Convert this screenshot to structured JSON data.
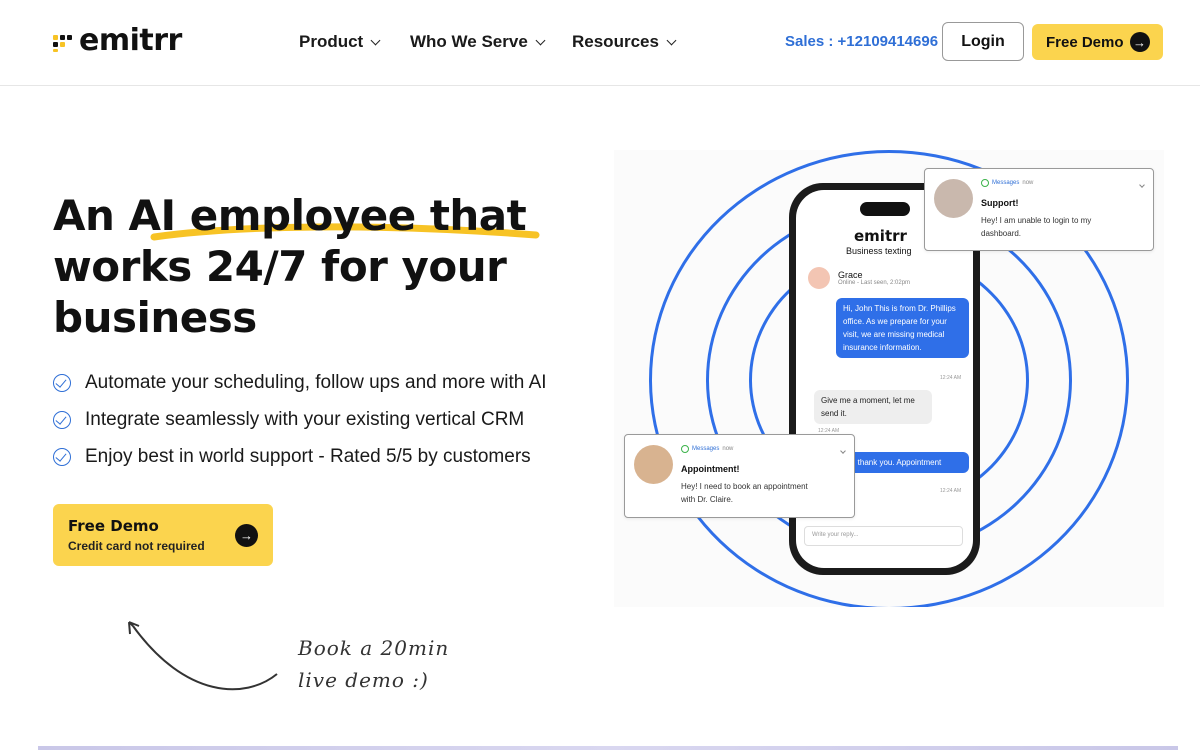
{
  "nav": {
    "logo_text": "emitrr",
    "menu": [
      {
        "label": "Product"
      },
      {
        "label": "Who We Serve"
      },
      {
        "label": "Resources"
      }
    ],
    "sales": "Sales : +12109414696",
    "login_label": "Login",
    "demo_label": "Free Demo"
  },
  "hero": {
    "line1": "An AI employee that",
    "line2": "works 24/7 for your",
    "line3": "business",
    "accent_color": "#f7c325",
    "bullets": [
      "Automate your scheduling, follow ups and more with AI",
      "Integrate seamlessly with your existing vertical CRM",
      "Enjoy best in world support - Rated 5/5 by customers"
    ],
    "cta_title": "Free Demo",
    "cta_sub": "Credit card not required",
    "handwritten_1": "Book a 20min",
    "handwritten_2": "live demo :)"
  },
  "phone": {
    "logo": "emitrr",
    "subtitle": "Business texting",
    "contact_name": "Grace",
    "contact_status": "Online - Last seen, 2:02pm",
    "messages": [
      {
        "from": "me",
        "text": "Hi, John This is from Dr. Phillips office. As we prepare for your visit, we are missing medical insurance information.",
        "time": "12:24 AM"
      },
      {
        "from": "them",
        "text": "Give me a moment, let me send it.",
        "time": "12:24 AM"
      },
      {
        "from": "me",
        "text": "Ok, thank you. Appointment",
        "time": "12:24 AM"
      }
    ],
    "reply_placeholder": "Write your reply..."
  },
  "notifications": [
    {
      "app": "Messages",
      "time": "now",
      "title": "Support!",
      "body": "Hey! I am unable to login to my dashboard."
    },
    {
      "app": "Messages",
      "time": "now",
      "title": "Appointment!",
      "body": "Hey! I need to book an appointment with Dr. Claire."
    }
  ],
  "colors": {
    "brand_yellow": "#fbd44e",
    "link_blue": "#2f6fd6",
    "ring_blue": "#2f6fe8"
  }
}
